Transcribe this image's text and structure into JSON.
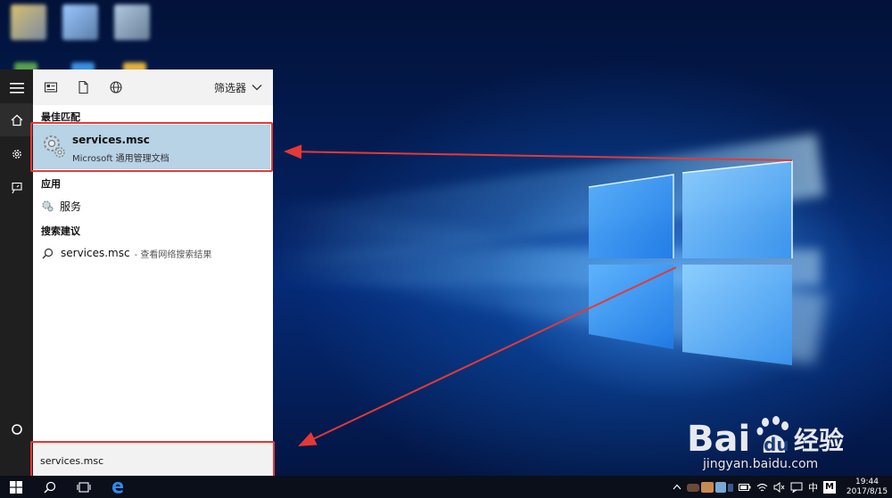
{
  "desktop": {
    "wallpaper": "windows-10-hero",
    "accent": "#1e88ff"
  },
  "start_rail": {
    "items": [
      {
        "name": "hamburger-menu",
        "icon": "menu-icon"
      },
      {
        "name": "home",
        "icon": "home-icon"
      },
      {
        "name": "settings",
        "icon": "gear-icon"
      },
      {
        "name": "feedback",
        "icon": "feedback-icon"
      },
      {
        "name": "cortana",
        "icon": "circle-icon"
      }
    ]
  },
  "search_toolbar": {
    "filter_label": "筛选器"
  },
  "results": {
    "best_match_title": "最佳匹配",
    "best_match": {
      "name": "services.msc",
      "subtitle": "Microsoft 通用管理文档",
      "icon": "services-gear-icon"
    },
    "apps_title": "应用",
    "apps": [
      {
        "label": "服务",
        "icon": "services-icon"
      }
    ],
    "suggestions_title": "搜索建议",
    "suggestions": [
      {
        "label": "services.msc",
        "hint": "- 查看网络搜索结果",
        "icon": "search-icon"
      }
    ]
  },
  "search_box": {
    "value": "services.msc"
  },
  "watermark": {
    "brand": "Bai",
    "brand2": "du",
    "product": "经验",
    "url": "jingyan.baidu.com"
  },
  "taskbar": {
    "tray": {
      "ime": "中",
      "ime2": "M",
      "time": "19:44",
      "date": "2017/8/15"
    }
  },
  "colors": {
    "highlight": "#e53935",
    "selected_row": "#b8d2e6"
  }
}
